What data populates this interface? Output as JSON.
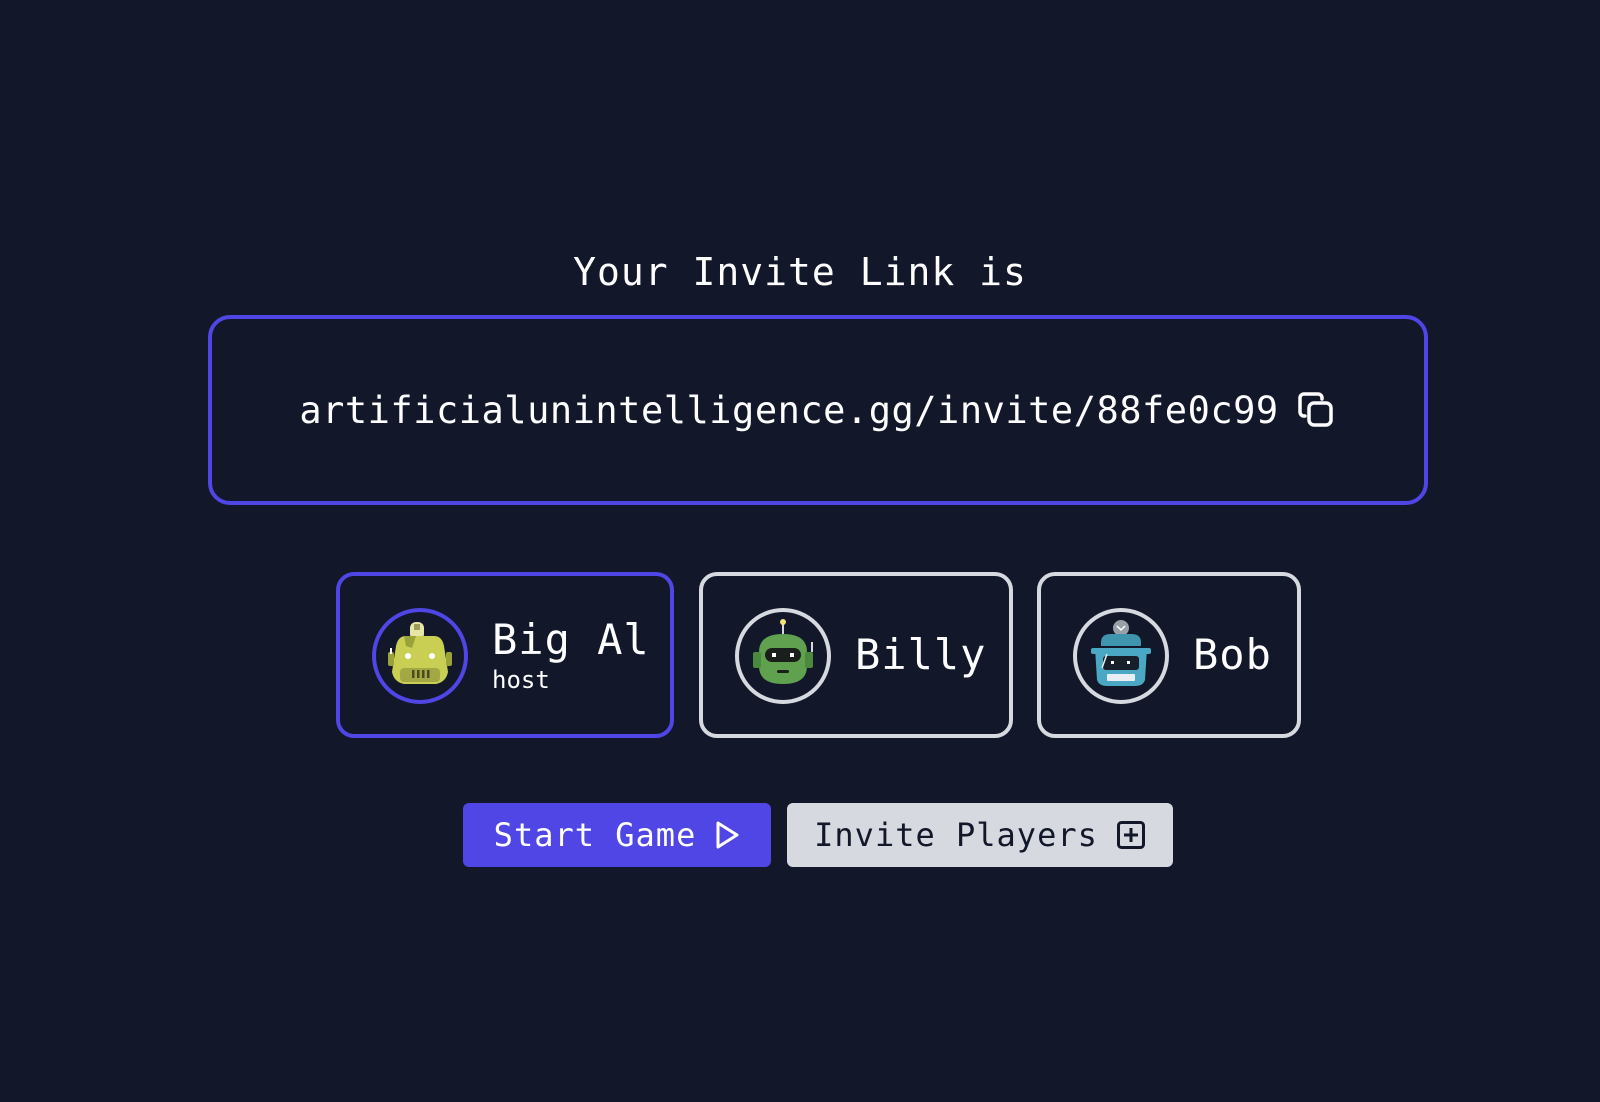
{
  "header": {
    "title": "Your Invite Link is"
  },
  "invite": {
    "link": "artificialunintelligence.gg/invite/88fe0c99",
    "copy_icon": "copy-icon"
  },
  "players": [
    {
      "name": "Big Al",
      "role": "host",
      "avatar": "yellow-robot-icon",
      "is_host": true
    },
    {
      "name": "Billy",
      "role": "",
      "avatar": "green-robot-icon",
      "is_host": false
    },
    {
      "name": "Bob",
      "role": "",
      "avatar": "blue-robot-icon",
      "is_host": false
    }
  ],
  "actions": {
    "start_label": "Start Game",
    "start_icon": "play-icon",
    "invite_label": "Invite Players",
    "invite_icon": "plus-square-icon"
  },
  "colors": {
    "background": "#12172a",
    "accent": "#4f46e5",
    "secondary": "#d6d9df",
    "text": "#ffffff"
  }
}
